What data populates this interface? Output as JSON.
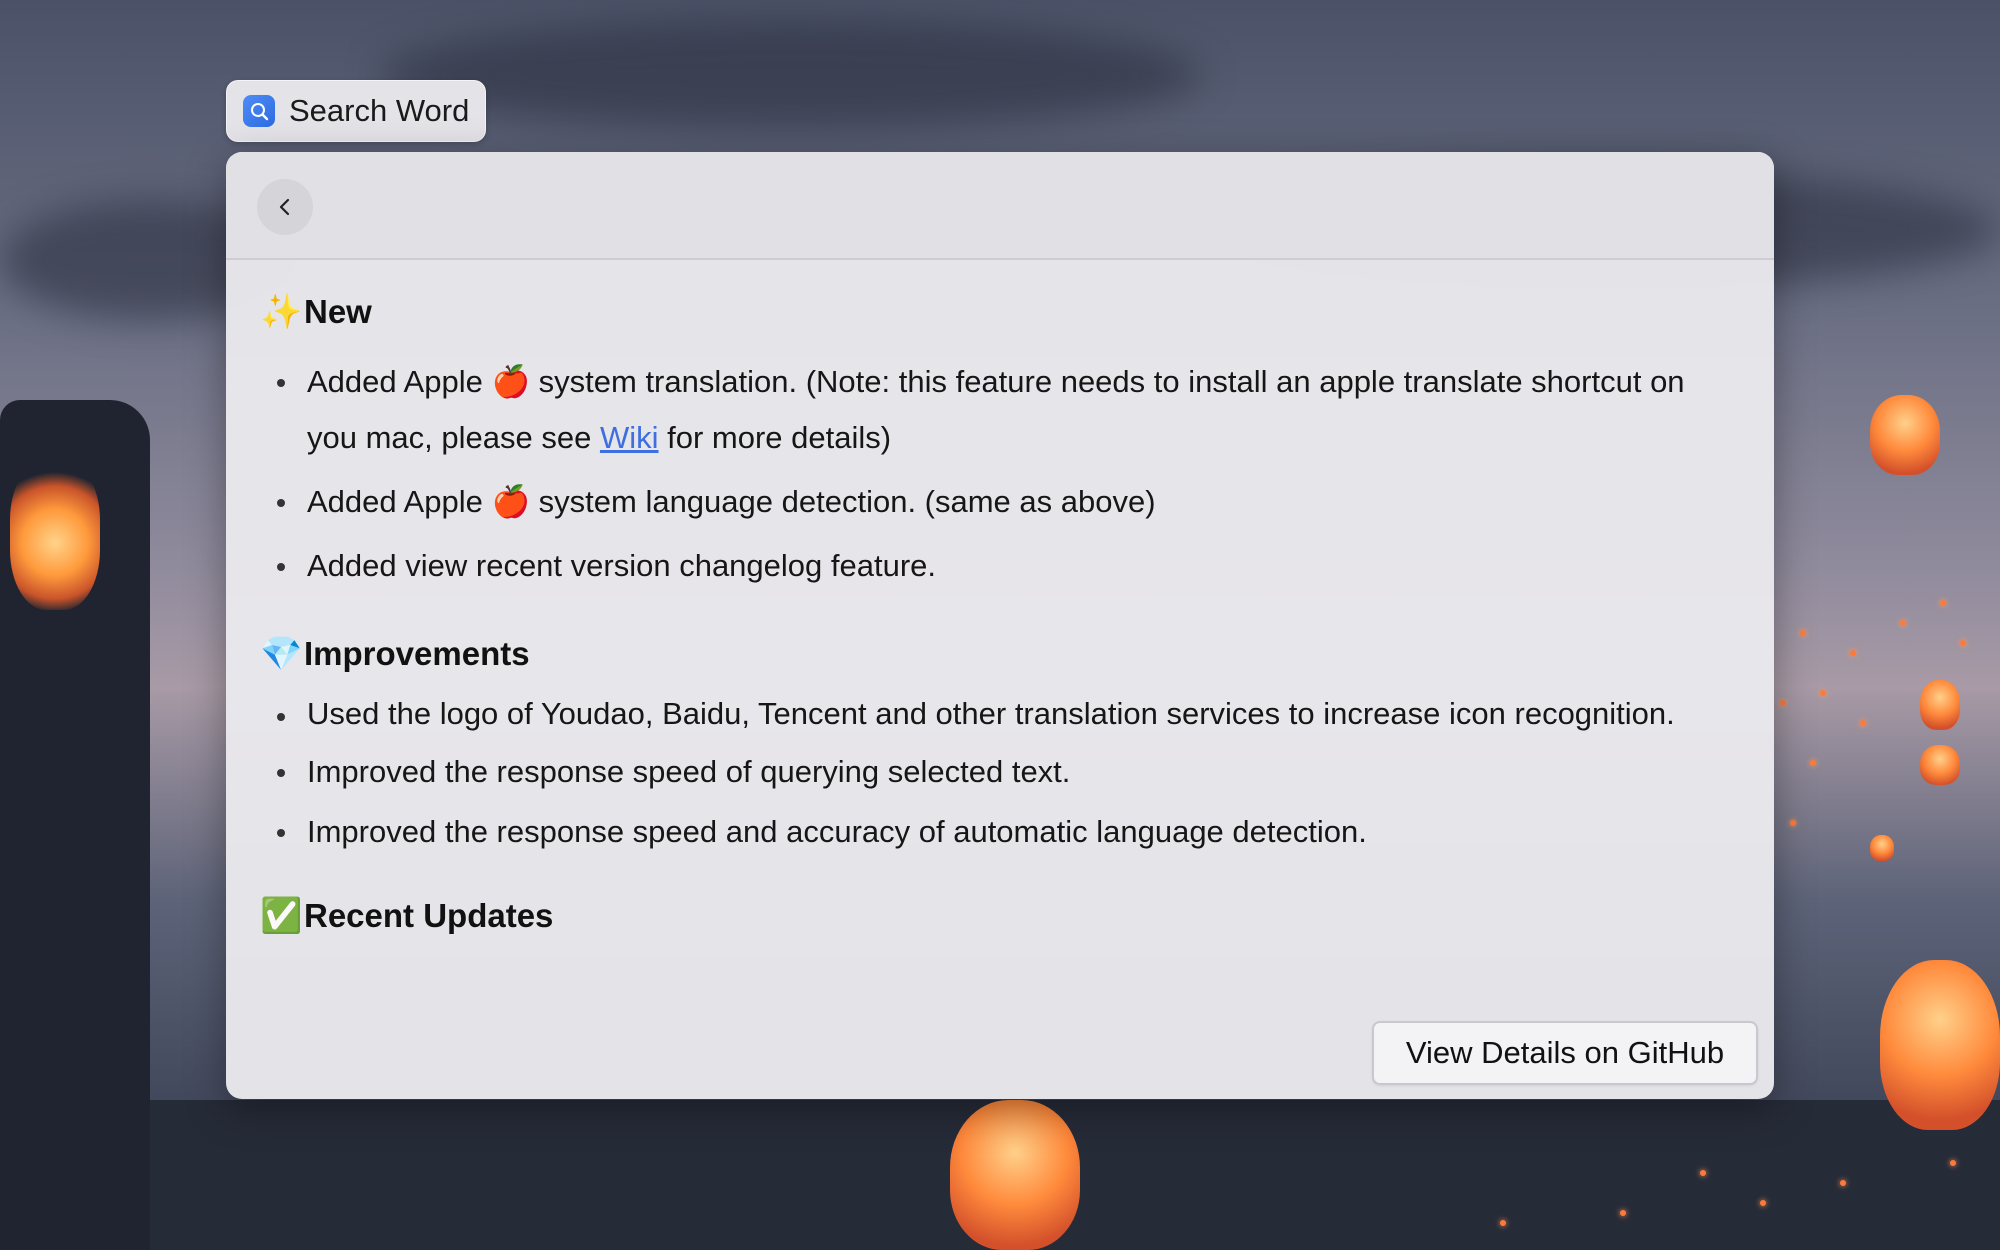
{
  "chip": {
    "label": "Search Word",
    "icon": "search-word-app-icon"
  },
  "panel": {
    "back_icon": "chevron-left-icon",
    "sections": [
      {
        "emoji": "✨",
        "title": "New",
        "items": [
          {
            "before": "Added Apple 🍎 system translation. (Note: this feature needs to install an apple translate shortcut on you mac, please see ",
            "link": "Wiki",
            "after": " for more details)"
          },
          {
            "text": "Added Apple 🍎 system language detection. (same as above)"
          },
          {
            "text": "Added view recent version changelog feature."
          }
        ]
      },
      {
        "emoji": "💎",
        "title": "Improvements",
        "items": [
          {
            "text": "Used the logo of Youdao, Baidu, Tencent and other translation services to increase icon recognition."
          },
          {
            "text": "Improved the response speed of querying selected text."
          },
          {
            "text": "Improved the response speed and accuracy of automatic language detection."
          }
        ]
      },
      {
        "emoji": "✅",
        "title": "Recent Updates"
      }
    ],
    "github_button": "View Details on GitHub"
  },
  "colors": {
    "link": "#3d6fe0",
    "chip_icon": "#2e6be0"
  }
}
